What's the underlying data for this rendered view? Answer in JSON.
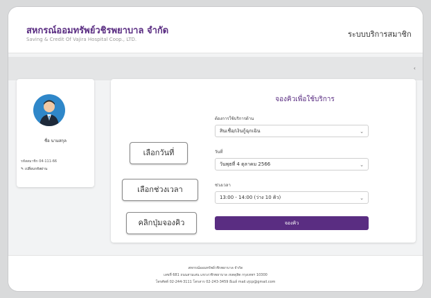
{
  "header": {
    "org_name": "สหกรณ์ออมทรัพย์วชิรพยาบาล จำกัด",
    "org_name_en": "Saving & Credit Of Vajira Hospital Coop., LTD.",
    "system_title": "ระบบบริการสมาชิก"
  },
  "subbar": {
    "mark": "‹"
  },
  "profile": {
    "name": "ชื่อ นามสกุล",
    "member_id": "รหัสสมาชิก 04-111-66",
    "edit_link": "เปลี่ยนรหัสผ่าน"
  },
  "booking": {
    "title": "จองคิวเพื่อใช้บริการ",
    "service_label": "ต้องการใช้บริการด้าน",
    "service_value": "สินเชื่อ/เงินกู้ฉุกเฉิน",
    "date_label": "วันที่",
    "date_value": "วันพุธที่ 4 ตุลาคม 2566",
    "time_label": "ช่วงเวลา",
    "time_value": "13:00 - 14:00 (ว่าง 10 คิว)",
    "submit_label": "จองคิว"
  },
  "callouts": {
    "choose_date": "เลือกวันที่",
    "choose_time": "เลือกช่วงเวลา",
    "click_book": "คลิกปุ่มจองคิว"
  },
  "footer": {
    "line1": "สหกรณ์ออมทรัพย์วชิรพยาบาล จำกัด",
    "line2": "เลขที่ 681 ถนนสามเสน แขวงวชิรพยาบาล เขตดุสิต กรุงเทพฯ 10300",
    "line3": "โทรศัพท์ 02-244-3111 โทรสาร 02-243-3459 อีเมล์ mail.vjcp@gmail.com"
  },
  "colors": {
    "brand": "#5a2d82",
    "avatar": "#2f87c9"
  }
}
